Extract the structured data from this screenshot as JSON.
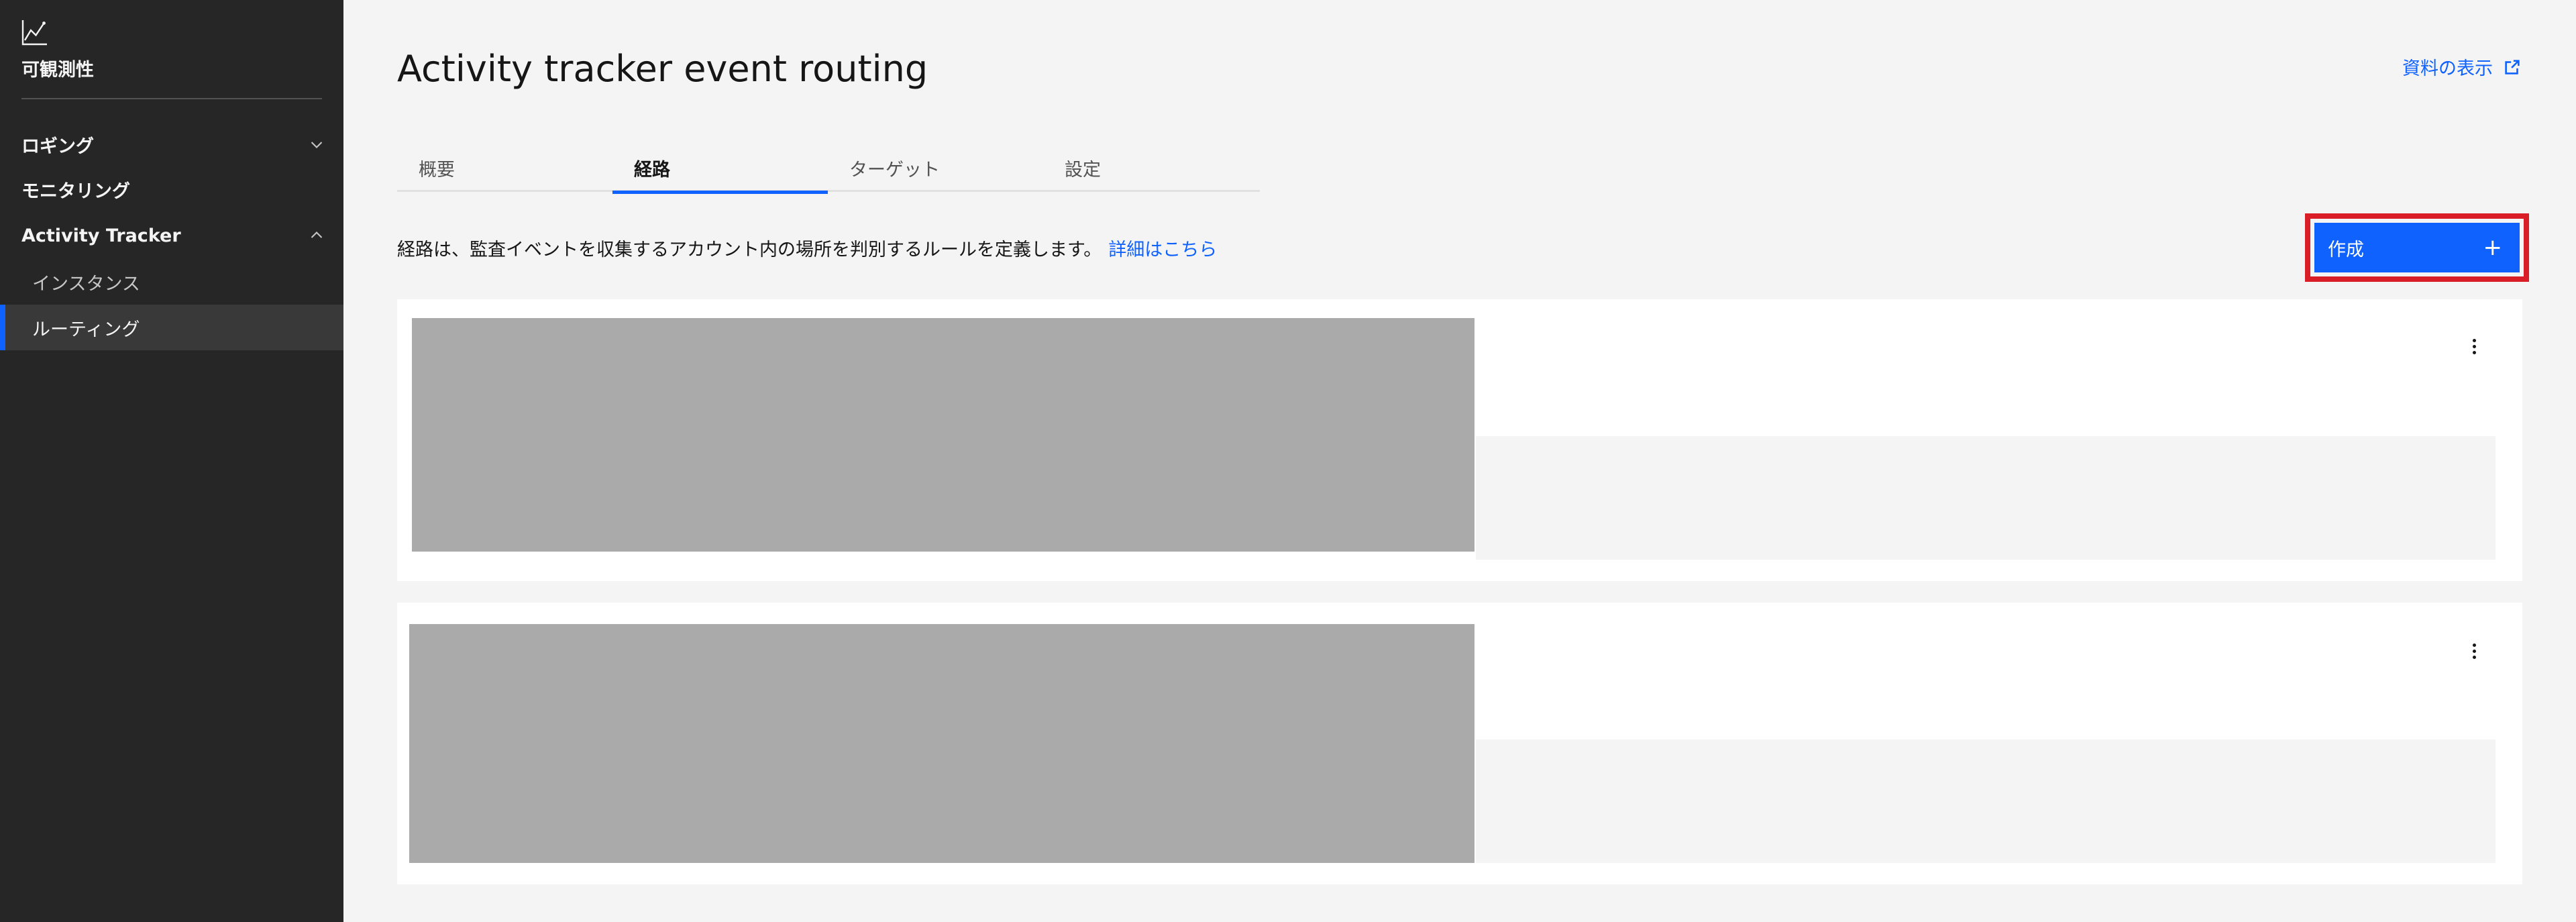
{
  "sidebar": {
    "icon": "line-chart-icon",
    "title": "可観測性",
    "items": [
      {
        "label": "ロギング",
        "expanded": false
      },
      {
        "label": "モニタリング"
      },
      {
        "label": "Activity Tracker",
        "expanded": true
      }
    ],
    "subitems": [
      {
        "label": "インスタンス"
      },
      {
        "label": "ルーティング",
        "active": true
      }
    ]
  },
  "header": {
    "title": "Activity tracker event routing",
    "doc_link": "資料の表示"
  },
  "tabs": [
    {
      "label": "概要"
    },
    {
      "label": "経路",
      "active": true
    },
    {
      "label": "ターゲット"
    },
    {
      "label": "設定"
    }
  ],
  "main": {
    "description": "経路は、監査イベントを収集するアカウント内の場所を判別するルールを定義します。",
    "learn_more": "詳細はこちら",
    "create_label": "作成",
    "create_icon": "+"
  },
  "colors": {
    "accent": "#0f62fe",
    "highlight": "#da1e28",
    "sidebar_bg": "#262626",
    "page_bg": "#f4f4f4"
  }
}
